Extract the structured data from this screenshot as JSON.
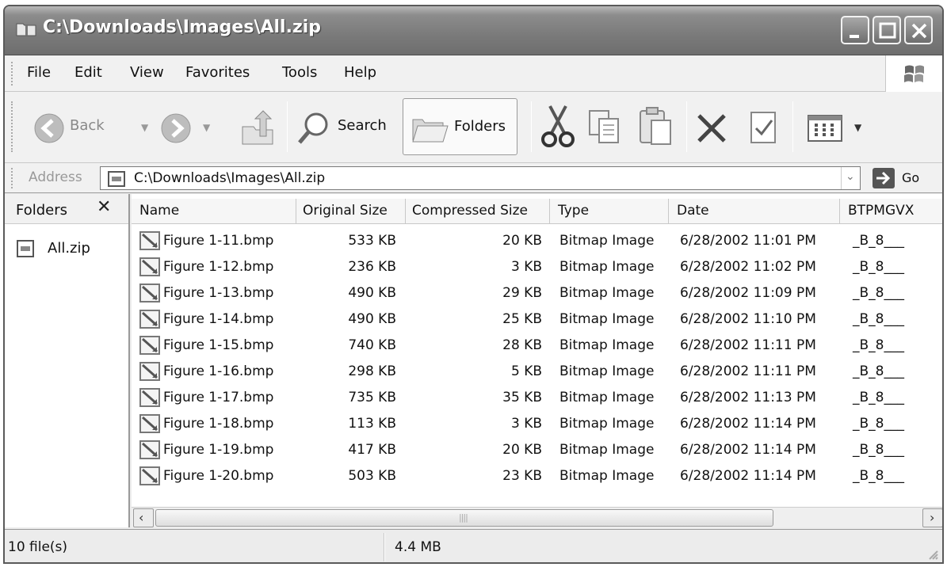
{
  "window": {
    "title": "C:\\Downloads\\Images\\All.zip"
  },
  "menu": {
    "items": [
      "File",
      "Edit",
      "View",
      "Favorites",
      "Tools",
      "Help"
    ]
  },
  "toolbar": {
    "back_label": "Back",
    "search_label": "Search",
    "folders_label": "Folders"
  },
  "address": {
    "label": "Address",
    "value": "C:\\Downloads\\Images\\All.zip",
    "go_label": "Go"
  },
  "folders_pane": {
    "title": "Folders",
    "items": [
      "All.zip"
    ]
  },
  "list": {
    "columns": [
      "Name",
      "Original Size",
      "Compressed Size",
      "Type",
      "Date",
      "BTPMGVX"
    ],
    "rows": [
      {
        "name": "Figure 1-11.bmp",
        "original": "533 KB",
        "compressed": "20 KB",
        "type": "Bitmap Image",
        "date": "6/28/2002 11:01 PM",
        "attr": "_B_8___"
      },
      {
        "name": "Figure 1-12.bmp",
        "original": "236 KB",
        "compressed": "3 KB",
        "type": "Bitmap Image",
        "date": "6/28/2002 11:02 PM",
        "attr": "_B_8___"
      },
      {
        "name": "Figure 1-13.bmp",
        "original": "490 KB",
        "compressed": "29 KB",
        "type": "Bitmap Image",
        "date": "6/28/2002 11:09 PM",
        "attr": "_B_8___"
      },
      {
        "name": "Figure 1-14.bmp",
        "original": "490 KB",
        "compressed": "25 KB",
        "type": "Bitmap Image",
        "date": "6/28/2002 11:10 PM",
        "attr": "_B_8___"
      },
      {
        "name": "Figure 1-15.bmp",
        "original": "740 KB",
        "compressed": "28 KB",
        "type": "Bitmap Image",
        "date": "6/28/2002 11:11 PM",
        "attr": "_B_8___"
      },
      {
        "name": "Figure 1-16.bmp",
        "original": "298 KB",
        "compressed": "5 KB",
        "type": "Bitmap Image",
        "date": "6/28/2002 11:11 PM",
        "attr": "_B_8___"
      },
      {
        "name": "Figure 1-17.bmp",
        "original": "735 KB",
        "compressed": "35 KB",
        "type": "Bitmap Image",
        "date": "6/28/2002 11:13 PM",
        "attr": "_B_8___"
      },
      {
        "name": "Figure 1-18.bmp",
        "original": "113 KB",
        "compressed": "3 KB",
        "type": "Bitmap Image",
        "date": "6/28/2002 11:14 PM",
        "attr": "_B_8___"
      },
      {
        "name": "Figure 1-19.bmp",
        "original": "417 KB",
        "compressed": "20 KB",
        "type": "Bitmap Image",
        "date": "6/28/2002 11:14 PM",
        "attr": "_B_8___"
      },
      {
        "name": "Figure 1-20.bmp",
        "original": "503 KB",
        "compressed": "23 KB",
        "type": "Bitmap Image",
        "date": "6/28/2002 11:14 PM",
        "attr": "_B_8___"
      }
    ]
  },
  "status": {
    "count": "10 file(s)",
    "size": "4.4 MB"
  },
  "icons": {
    "title": "zip-folder-icon",
    "file": "bitmap-file-icon"
  }
}
